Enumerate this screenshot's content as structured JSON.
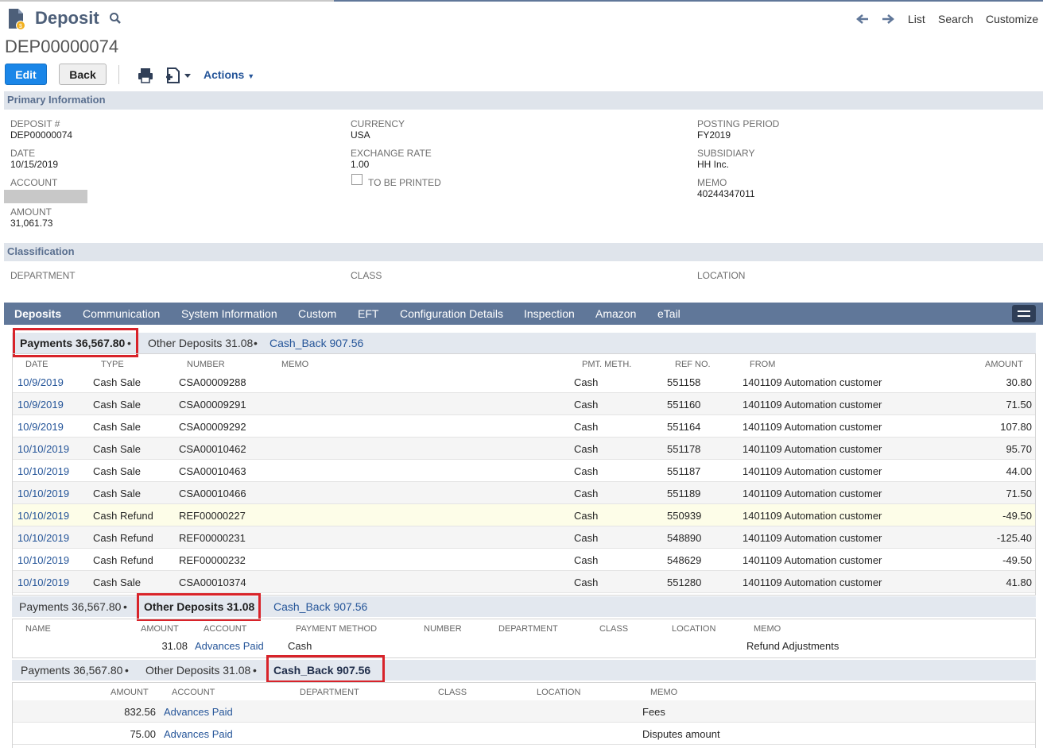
{
  "header": {
    "title": "Deposit",
    "record_id": "DEP00000074",
    "nav": {
      "list": "List",
      "search": "Search",
      "customize": "Customize"
    }
  },
  "toolbar": {
    "edit": "Edit",
    "back": "Back",
    "actions": "Actions"
  },
  "primary": {
    "section_title": "Primary Information",
    "deposit_label": "DEPOSIT #",
    "deposit_value": "DEP00000074",
    "date_label": "DATE",
    "date_value": "10/15/2019",
    "account_label": "ACCOUNT",
    "amount_label": "AMOUNT",
    "amount_value": "31,061.73",
    "currency_label": "CURRENCY",
    "currency_value": "USA",
    "exrate_label": "EXCHANGE RATE",
    "exrate_value": "1.00",
    "tobeprinted_label": "TO BE PRINTED",
    "period_label": "POSTING PERIOD",
    "period_value": "FY2019",
    "subsidiary_label": "SUBSIDIARY",
    "subsidiary_value": "HH Inc.",
    "memo_label": "MEMO",
    "memo_value": "40244347011"
  },
  "classification": {
    "section_title": "Classification",
    "department_label": "DEPARTMENT",
    "class_label": "CLASS",
    "location_label": "LOCATION"
  },
  "tabs": [
    "Deposits",
    "Communication",
    "System Information",
    "Custom",
    "EFT",
    "Configuration Details",
    "Inspection",
    "Amazon",
    "eTail"
  ],
  "subtabs": {
    "payments": "Payments 36,567.80",
    "other": "Other Deposits 31.08",
    "cashback": "Cash_Back 907.56",
    "bullet": "•"
  },
  "payments": {
    "headers": [
      "DATE",
      "TYPE",
      "NUMBER",
      "MEMO",
      "PMT. METH.",
      "REF NO.",
      "FROM",
      "AMOUNT"
    ],
    "rows": [
      {
        "date": "10/9/2019",
        "type": "Cash Sale",
        "number": "CSA00009288",
        "method": "Cash",
        "ref": "551158",
        "from": "1401109 Automation customer",
        "amount": "30.80"
      },
      {
        "date": "10/9/2019",
        "type": "Cash Sale",
        "number": "CSA00009291",
        "method": "Cash",
        "ref": "551160",
        "from": "1401109 Automation customer",
        "amount": "71.50"
      },
      {
        "date": "10/9/2019",
        "type": "Cash Sale",
        "number": "CSA00009292",
        "method": "Cash",
        "ref": "551164",
        "from": "1401109 Automation customer",
        "amount": "107.80"
      },
      {
        "date": "10/10/2019",
        "type": "Cash Sale",
        "number": "CSA00010462",
        "method": "Cash",
        "ref": "551178",
        "from": "1401109 Automation customer",
        "amount": "95.70"
      },
      {
        "date": "10/10/2019",
        "type": "Cash Sale",
        "number": "CSA00010463",
        "method": "Cash",
        "ref": "551187",
        "from": "1401109 Automation customer",
        "amount": "44.00"
      },
      {
        "date": "10/10/2019",
        "type": "Cash Sale",
        "number": "CSA00010466",
        "method": "Cash",
        "ref": "551189",
        "from": "1401109 Automation customer",
        "amount": "71.50"
      },
      {
        "date": "10/10/2019",
        "type": "Cash Refund",
        "number": "REF00000227",
        "method": "Cash",
        "ref": "550939",
        "from": "1401109 Automation customer",
        "amount": "-49.50"
      },
      {
        "date": "10/10/2019",
        "type": "Cash Refund",
        "number": "REF00000231",
        "method": "Cash",
        "ref": "548890",
        "from": "1401109 Automation customer",
        "amount": "-125.40"
      },
      {
        "date": "10/10/2019",
        "type": "Cash Refund",
        "number": "REF00000232",
        "method": "Cash",
        "ref": "548629",
        "from": "1401109 Automation customer",
        "amount": "-49.50"
      },
      {
        "date": "10/10/2019",
        "type": "Cash Sale",
        "number": "CSA00010374",
        "method": "Cash",
        "ref": "551280",
        "from": "1401109 Automation customer",
        "amount": "41.80"
      }
    ]
  },
  "other_deposits": {
    "headers": [
      "NAME",
      "AMOUNT",
      "ACCOUNT",
      "PAYMENT METHOD",
      "NUMBER",
      "DEPARTMENT",
      "CLASS",
      "LOCATION",
      "MEMO"
    ],
    "row": {
      "amount": "31.08",
      "account": "Advances Paid",
      "method": "Cash",
      "memo": "Refund Adjustments"
    }
  },
  "cash_back": {
    "headers": [
      "AMOUNT",
      "ACCOUNT",
      "DEPARTMENT",
      "CLASS",
      "LOCATION",
      "MEMO"
    ],
    "rows": [
      {
        "amount": "832.56",
        "account": "Advances Paid",
        "memo": "Fees"
      },
      {
        "amount": "75.00",
        "account": "Advances Paid",
        "memo": "Disputes amount"
      }
    ]
  }
}
